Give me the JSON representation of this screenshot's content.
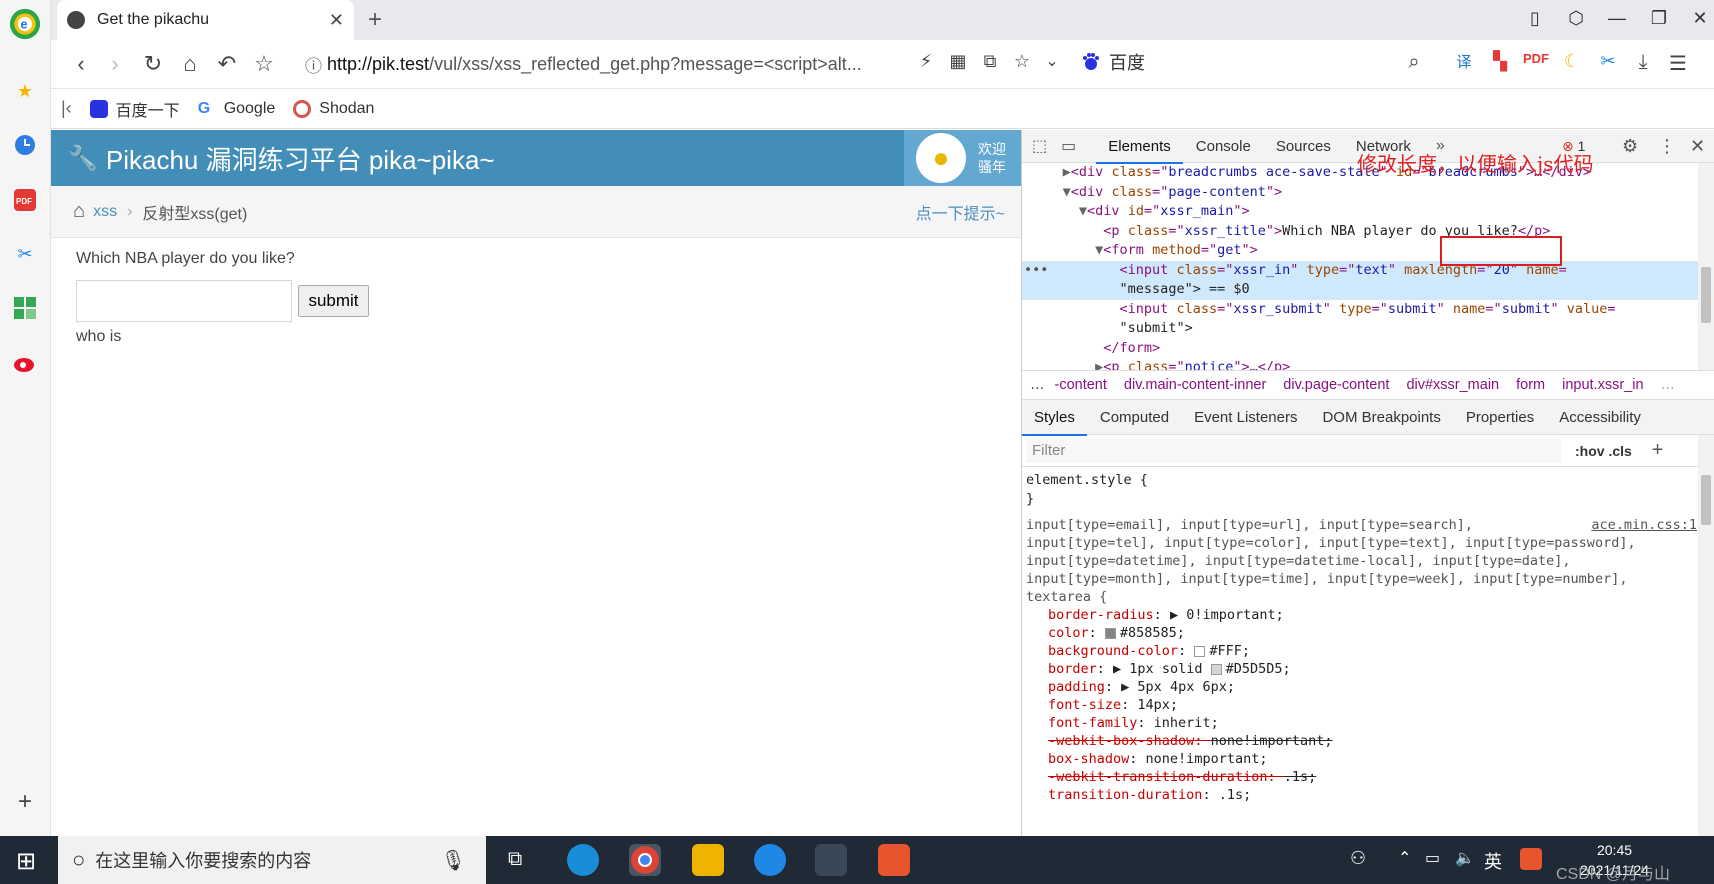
{
  "browser": {
    "tab_title": "Get the pikachu",
    "url_host": "http://pik.test",
    "url_path": "/vul/xss/xss_reflected_get.php?message=<script>alt...",
    "search_engine": "百度",
    "bookmarks": [
      "百度一下",
      "Google",
      "Shodan"
    ]
  },
  "page": {
    "app_title": "Pikachu 漏洞练习平台 pika~pika~",
    "welcome_line1": "欢迎",
    "welcome_line2": "骚年",
    "breadcrumb_link": "xss",
    "breadcrumb_current": "反射型xss(get)",
    "hint_link": "点一下提示~",
    "question": "Which NBA player do you like?",
    "submit_label": "submit",
    "notice": "who is"
  },
  "devtools": {
    "tabs": [
      "Elements",
      "Console",
      "Sources",
      "Network"
    ],
    "error_count": "1",
    "annotation": "修改长度，以便输入js代码",
    "dom_lines": [
      {
        "pre": "     ▶",
        "tag": "<div",
        "attrs": [
          [
            "class",
            "breadcrumbs ace-save-state"
          ],
          [
            "id",
            "breadcrumbs"
          ]
        ],
        "post": ">…</div>"
      },
      {
        "pre": "     ▼",
        "tag": "<div",
        "attrs": [
          [
            "class",
            "page-content"
          ]
        ],
        "post": ">"
      },
      {
        "pre": "       ▼",
        "tag": "<div",
        "attrs": [
          [
            "id",
            "xssr_main"
          ]
        ],
        "post": ">"
      },
      {
        "pre": "          ",
        "tag": "<p",
        "attrs": [
          [
            "class",
            "xssr_title"
          ]
        ],
        "post": ">",
        "text": "Which NBA player do you like?",
        "close": "</p>"
      },
      {
        "pre": "         ▼",
        "tag": "<form",
        "attrs": [
          [
            "method",
            "get"
          ]
        ],
        "post": ">"
      },
      {
        "pre": "            ",
        "tag": "<input",
        "attrs": [
          [
            "class",
            "xssr_in"
          ],
          [
            "type",
            "text"
          ],
          [
            "maxlength",
            "20"
          ],
          [
            "name",
            ""
          ]
        ],
        "post": "",
        "selected": true
      },
      {
        "pre": "            ",
        "tag": "",
        "attrs": [],
        "post": "",
        "text": "\"message\"> == $0",
        "selected": true
      },
      {
        "pre": "            ",
        "tag": "<input",
        "attrs": [
          [
            "class",
            "xssr_submit"
          ],
          [
            "type",
            "submit"
          ],
          [
            "name",
            "submit"
          ],
          [
            "value",
            ""
          ]
        ],
        "post": ""
      },
      {
        "pre": "            ",
        "tag": "",
        "attrs": [],
        "post": "",
        "text": "\"submit\">"
      },
      {
        "pre": "          ",
        "tag": "</form>",
        "attrs": [],
        "post": ""
      },
      {
        "pre": "         ▶",
        "tag": "<p",
        "attrs": [
          [
            "class",
            "notice"
          ]
        ],
        "post": ">…</p>"
      },
      {
        "pre": "        ",
        "tag": "</div>",
        "attrs": [],
        "post": ""
      }
    ],
    "crumbs": [
      "…",
      "-content",
      "div.main-content-inner",
      "div.page-content",
      "div#xssr_main",
      "form",
      "input.xssr_in",
      "…"
    ],
    "styles_tabs": [
      "Styles",
      "Computed",
      "Event Listeners",
      "DOM Breakpoints",
      "Properties",
      "Accessibility"
    ],
    "filter_placeholder": "Filter",
    "filter_opts": ":hov  .cls",
    "element_style": "element.style {",
    "close_brace": "}",
    "rule_source": "ace.min.css:1",
    "selector_lines": [
      "input[type=email], input[type=url], input[type=search],",
      "input[type=tel], input[type=color], input[type=text], input[type=password],",
      "input[type=datetime], input[type=datetime-local], input[type=date],",
      "input[type=month], input[type=time], input[type=week], input[type=number],",
      "textarea {"
    ],
    "props": [
      {
        "name": "border-radius",
        "value": "▶ 0!important;",
        "strike": false
      },
      {
        "name": "color",
        "value": "#858585;",
        "swatch": "#858585",
        "strike": false
      },
      {
        "name": "background-color",
        "value": "#FFF;",
        "swatch": "#FFFFFF",
        "strike": false
      },
      {
        "name": "border",
        "value": "▶ 1px solid ",
        "swatch2": "#D5D5D5",
        "value2": "#D5D5D5;",
        "strike": false
      },
      {
        "name": "padding",
        "value": "▶ 5px 4px 6px;",
        "strike": false
      },
      {
        "name": "font-size",
        "value": "14px;",
        "strike": false
      },
      {
        "name": "font-family",
        "value": "inherit;",
        "strike": false
      },
      {
        "name": "-webkit-box-shadow",
        "value": "none!important;",
        "strike": true
      },
      {
        "name": "box-shadow",
        "value": "none!important;",
        "strike": false
      },
      {
        "name": "-webkit-transition-duration",
        "value": ".1s;",
        "strike": true
      },
      {
        "name": "transition-duration",
        "value": ".1s;",
        "strike": false
      }
    ]
  },
  "taskbar": {
    "search_placeholder": "在这里输入你要搜索的内容",
    "ime": "英",
    "time": "20:45",
    "date": "2021/11/24",
    "watermark": "CSDN @月与山"
  }
}
